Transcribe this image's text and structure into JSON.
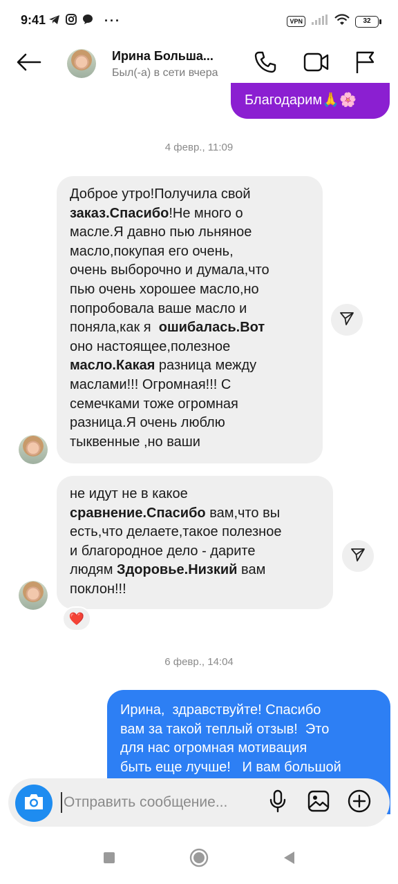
{
  "status_bar": {
    "time": "9:41",
    "left_icons": [
      "telegram-icon",
      "instagram-icon",
      "chat-bubble-icon"
    ],
    "more": "···",
    "vpn": "VPN",
    "battery": "32"
  },
  "header": {
    "name": "Ирина Больша...",
    "status": "Был(-а) в сети вчера",
    "icons": [
      "back-arrow-icon",
      "phone-icon",
      "video-camera-icon",
      "flag-icon"
    ]
  },
  "messages": {
    "outgoing_top": "Благодарим🙏🌸",
    "timestamp_1": "4 февр., 11:09",
    "incoming_1": [
      [
        {
          "t": "Доброе утро!Получила свой",
          "b": false
        }
      ],
      [
        {
          "t": "заказ.Спасибо",
          "b": true
        },
        {
          "t": "!Не много о",
          "b": false
        }
      ],
      [
        {
          "t": "масле.Я давно пью льняное",
          "b": false
        }
      ],
      [
        {
          "t": "масло,покупая его очень,",
          "b": false
        }
      ],
      [
        {
          "t": "очень выборочно и думала,что",
          "b": false
        }
      ],
      [
        {
          "t": "пью очень хорошее масло,но",
          "b": false
        }
      ],
      [
        {
          "t": "попробовала ваше масло и",
          "b": false
        }
      ],
      [
        {
          "t": "поняла,как я  ",
          "b": false
        },
        {
          "t": "ошибалась.Вот",
          "b": true
        }
      ],
      [
        {
          "t": "оно настоящее,полезное",
          "b": false
        }
      ],
      [
        {
          "t": "масло.Какая",
          "b": true
        },
        {
          "t": " разница между",
          "b": false
        }
      ],
      [
        {
          "t": "маслами!!! Огромная!!! С",
          "b": false
        }
      ],
      [
        {
          "t": "семечками тоже огромная",
          "b": false
        }
      ],
      [
        {
          "t": "разница.Я очень люблю",
          "b": false
        }
      ],
      [
        {
          "t": "тыквенные ,но ваши",
          "b": false
        }
      ]
    ],
    "incoming_2": [
      [
        {
          "t": "не идут не в какое",
          "b": false
        }
      ],
      [
        {
          "t": "сравнение.Спасибо",
          "b": true
        },
        {
          "t": " вам,что вы",
          "b": false
        }
      ],
      [
        {
          "t": "есть,что делаете,такое полезное",
          "b": false
        }
      ],
      [
        {
          "t": "и благородное дело - дарите",
          "b": false
        }
      ],
      [
        {
          "t": "людям ",
          "b": false
        },
        {
          "t": "Здоровье.Низкий",
          "b": true
        },
        {
          "t": " вам",
          "b": false
        }
      ],
      [
        {
          "t": "поклон!!!",
          "b": false
        }
      ]
    ],
    "reaction": "❤️",
    "timestamp_2": "6 февр., 14:04",
    "outgoing_bottom": "Ирина,  здравствуйте! Спасибо\nвам за такой теплый отзыв!  Это\nдля нас огромная мотивация\nбыть еще лучше!   И вам большой"
  },
  "composer": {
    "placeholder": "Отправить сообщение...",
    "icons": [
      "camera-icon",
      "microphone-icon",
      "gallery-icon",
      "plus-circle-icon"
    ]
  },
  "nav": {
    "icons": [
      "recent-apps-icon",
      "home-icon",
      "back-icon"
    ]
  },
  "colors": {
    "outgoing_purple": "#8b1fd1",
    "outgoing_blue": "#2d7ff4",
    "incoming_gray": "#efefef",
    "camera_blue": "#1e8cf0"
  }
}
